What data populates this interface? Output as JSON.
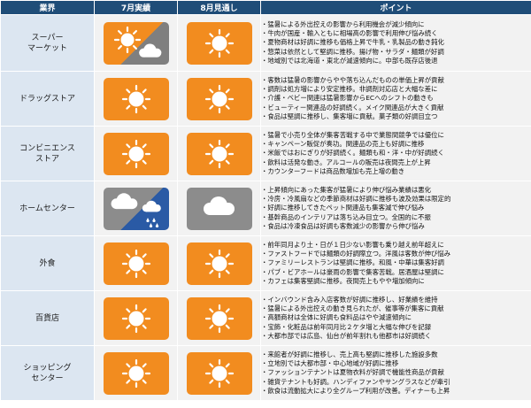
{
  "headers": {
    "category": "業界",
    "july": "7月実績",
    "august": "8月見通し",
    "points": "ポイント"
  },
  "rows": [
    {
      "name_lines": [
        "スーパー",
        "マーケット"
      ],
      "july": {
        "icon": "sun-cloud-icon"
      },
      "august": {
        "icon": "sun-icon"
      },
      "points": [
        "・猛暑による外出控えの影響から利用機会が減少傾向に",
        "・牛肉が国産・輸入ともに相場高の影響で利用伸び悩み続く",
        "・夏物商材は好調に推移も価格上昇で牛乳・乳製品の動き鈍化",
        "・惣菜は依然として堅調に推移。揚げ物・サラダ・麺類が好調",
        "・地域別では北海道・東北が減速傾向に。中部も既存店後退"
      ]
    },
    {
      "name_lines": [
        "ドラッグストア"
      ],
      "july": {
        "icon": "sun-icon"
      },
      "august": {
        "icon": "sun-icon"
      },
      "points": [
        "・客数は猛暑の影響からやや落ち込んだものの単価上昇が貢献",
        "・調剤は処方増により安定推移。非調剤対応店と大幅な差に",
        "・介護・ベビー関連は猛暑影響からECへのシフトの動きも",
        "・ビューティー関連品の好調続く。メイク関連品が大きく貢献",
        "・食品は堅調に推移し、集客増に貢献。菓子類の好調目立つ"
      ]
    },
    {
      "name_lines": [
        "コンビニエンス",
        "ストア"
      ],
      "july": {
        "icon": "sun-icon"
      },
      "august": {
        "icon": "sun-icon"
      },
      "points": [
        "・猛暑で小売り全体が集客苦戦する中で業態間競争では優位に",
        "・キャンペーン販促が奏功。関連品の売上も好調に推移",
        "・米飯ではおにぎりが好調続く。麺類も和・洋・中が好調続く",
        "・飲料は活発な動き。アルコールの販売は夜間売上が上昇",
        "・カウンターフードは商品数増加も売上増の動き"
      ]
    },
    {
      "name_lines": [
        "ホームセンター"
      ],
      "july": {
        "icon": "cloud-rain-icon"
      },
      "august": {
        "icon": "cloud-icon"
      },
      "points": [
        "・上昇傾向にあった集客が猛暑により伸び悩み業績は悪化",
        "・冷房・冷風扇などの季節商材は好調に推移も波及効果は限定的",
        "・好調に推移してきたペット関連品も集客減で伸び悩み",
        "・基幹商品のインテリアは落ち込み目立つ。全国的に不振",
        "・食品は冷凍食品は好調も客数減少の影響から伸び悩み"
      ]
    },
    {
      "name_lines": [
        "外食"
      ],
      "july": {
        "icon": "sun-icon"
      },
      "august": {
        "icon": "sun-icon"
      },
      "points": [
        "・前年同月より土・日が１日少ない影響も乗り越え前年超えに",
        "・ファストフードでは麺類の好調際立つ。洋風は客数が伸び悩み",
        "・ファミリーレストランは堅調に推移。和風・中華は集客好調",
        "・パブ・ビアホールは豪雨の影響で集客苦戦。居酒屋は堅調に",
        "・カフェは集客堅調に推移。夜間売上もやや増加傾向に"
      ]
    },
    {
      "name_lines": [
        "百貨店"
      ],
      "july": {
        "icon": "sun-icon"
      },
      "august": {
        "icon": "sun-icon"
      },
      "points": [
        "・インバウンド含み入店客数が好調に推移し、好業績を維持",
        "・猛暑による外出控えの動き見られたが、催事等が集客に貢献",
        "・高額商材は全体に好調も食料品はやや減速傾向に",
        "・宝飾・化粧品は前年同月比２ケタ増と大幅な伸びを記録",
        "・大都市部では広島、仙台が前年割れも他都市は好調続く"
      ]
    },
    {
      "name_lines": [
        "ショッピング",
        "センター"
      ],
      "july": {
        "icon": "sun-icon"
      },
      "august": {
        "icon": "sun-icon"
      },
      "points": [
        "・来館者が好調に推移し、売上高も堅調に推移した施設多数",
        "・立地別では大都市部・中心地域が好調に推移",
        "・ファッションテナントは夏物衣料が好調で機能性商品が貢献",
        "・雑貨テナントも好調。ハンディファンやサングラスなどが牽引",
        "・飲食は流動拡大により全グループ利用が改善。ディナーも上昇"
      ]
    }
  ],
  "colors": {
    "header_bg": "#1f4d78",
    "category_bg": "#dce6f1",
    "cell_bg": "#f2f2f2",
    "sunny_bg": "#f28c1f",
    "cloud_bg": "#8c8c8c",
    "rain_bg": "#2a5aa5"
  }
}
